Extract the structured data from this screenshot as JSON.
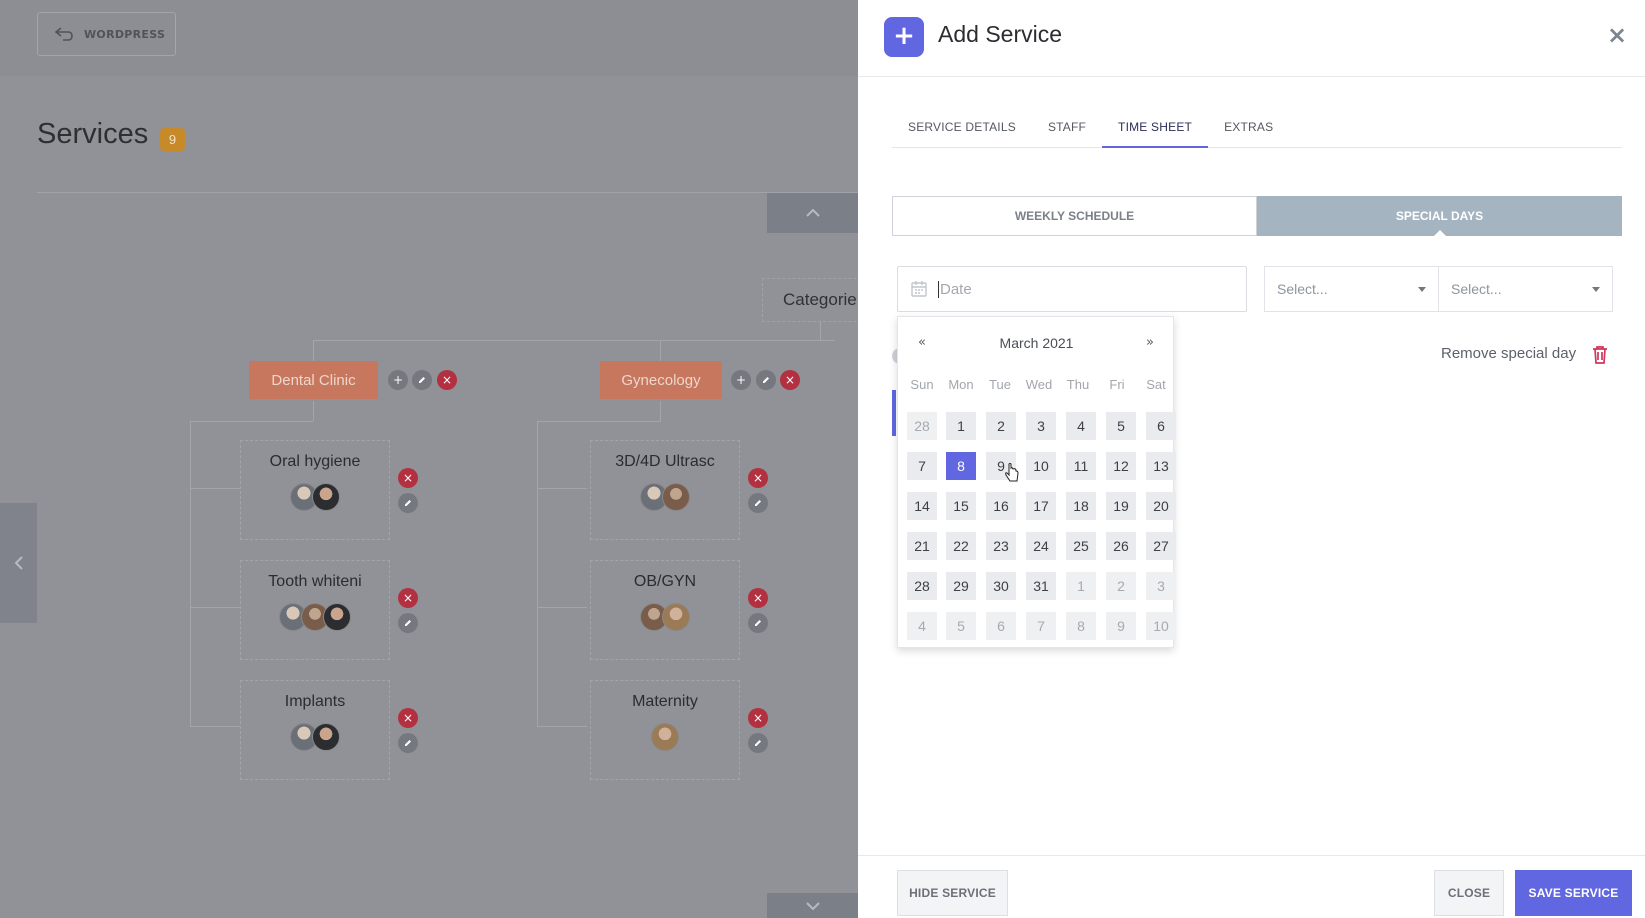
{
  "background": {
    "wordpress_label": "WORDPRESS",
    "page_title": "Services",
    "services_count": "9",
    "category_label": "Categorie",
    "departments": [
      {
        "name": "Dental Clinic",
        "services": [
          "Oral hygiene",
          "Tooth whiteni",
          "Implants"
        ]
      },
      {
        "name": "Gynecology",
        "services": [
          "3D/4D Ultrasc",
          "OB/GYN",
          "Maternity"
        ]
      }
    ]
  },
  "drawer": {
    "title": "Add Service",
    "close_symbol": "×",
    "tabs": [
      {
        "label": "SERVICE DETAILS",
        "active": false
      },
      {
        "label": "STAFF",
        "active": false
      },
      {
        "label": "TIME SHEET",
        "active": true
      },
      {
        "label": "EXTRAS",
        "active": false
      }
    ],
    "segments": [
      {
        "label": "WEEKLY SCHEDULE",
        "active": false
      },
      {
        "label": "SPECIAL DAYS",
        "active": true
      }
    ],
    "date_placeholder": "Date",
    "select_1_placeholder": "Select...",
    "select_2_placeholder": "Select...",
    "remove_special_day": "Remove special day",
    "calendar": {
      "prev": "«",
      "next": "»",
      "month_label": "March 2021",
      "weekdays": [
        "Sun",
        "Mon",
        "Tue",
        "Wed",
        "Thu",
        "Fri",
        "Sat"
      ],
      "selected_day": "8",
      "weeks": [
        [
          "28",
          "1",
          "2",
          "3",
          "4",
          "5",
          "6"
        ],
        [
          "7",
          "8",
          "9",
          "10",
          "11",
          "12",
          "13"
        ],
        [
          "14",
          "15",
          "16",
          "17",
          "18",
          "19",
          "20"
        ],
        [
          "21",
          "22",
          "23",
          "24",
          "25",
          "26",
          "27"
        ],
        [
          "28",
          "29",
          "30",
          "31",
          "1",
          "2",
          "3"
        ],
        [
          "4",
          "5",
          "6",
          "7",
          "8",
          "9",
          "10"
        ]
      ]
    },
    "footer": {
      "hide_label": "HIDE SERVICE",
      "close_label": "CLOSE",
      "save_label": "SAVE SERVICE"
    }
  },
  "colors": {
    "accent": "#6166e1",
    "department": "#c7775e",
    "danger": "#b33040",
    "count_badge": "#c78a2a"
  }
}
